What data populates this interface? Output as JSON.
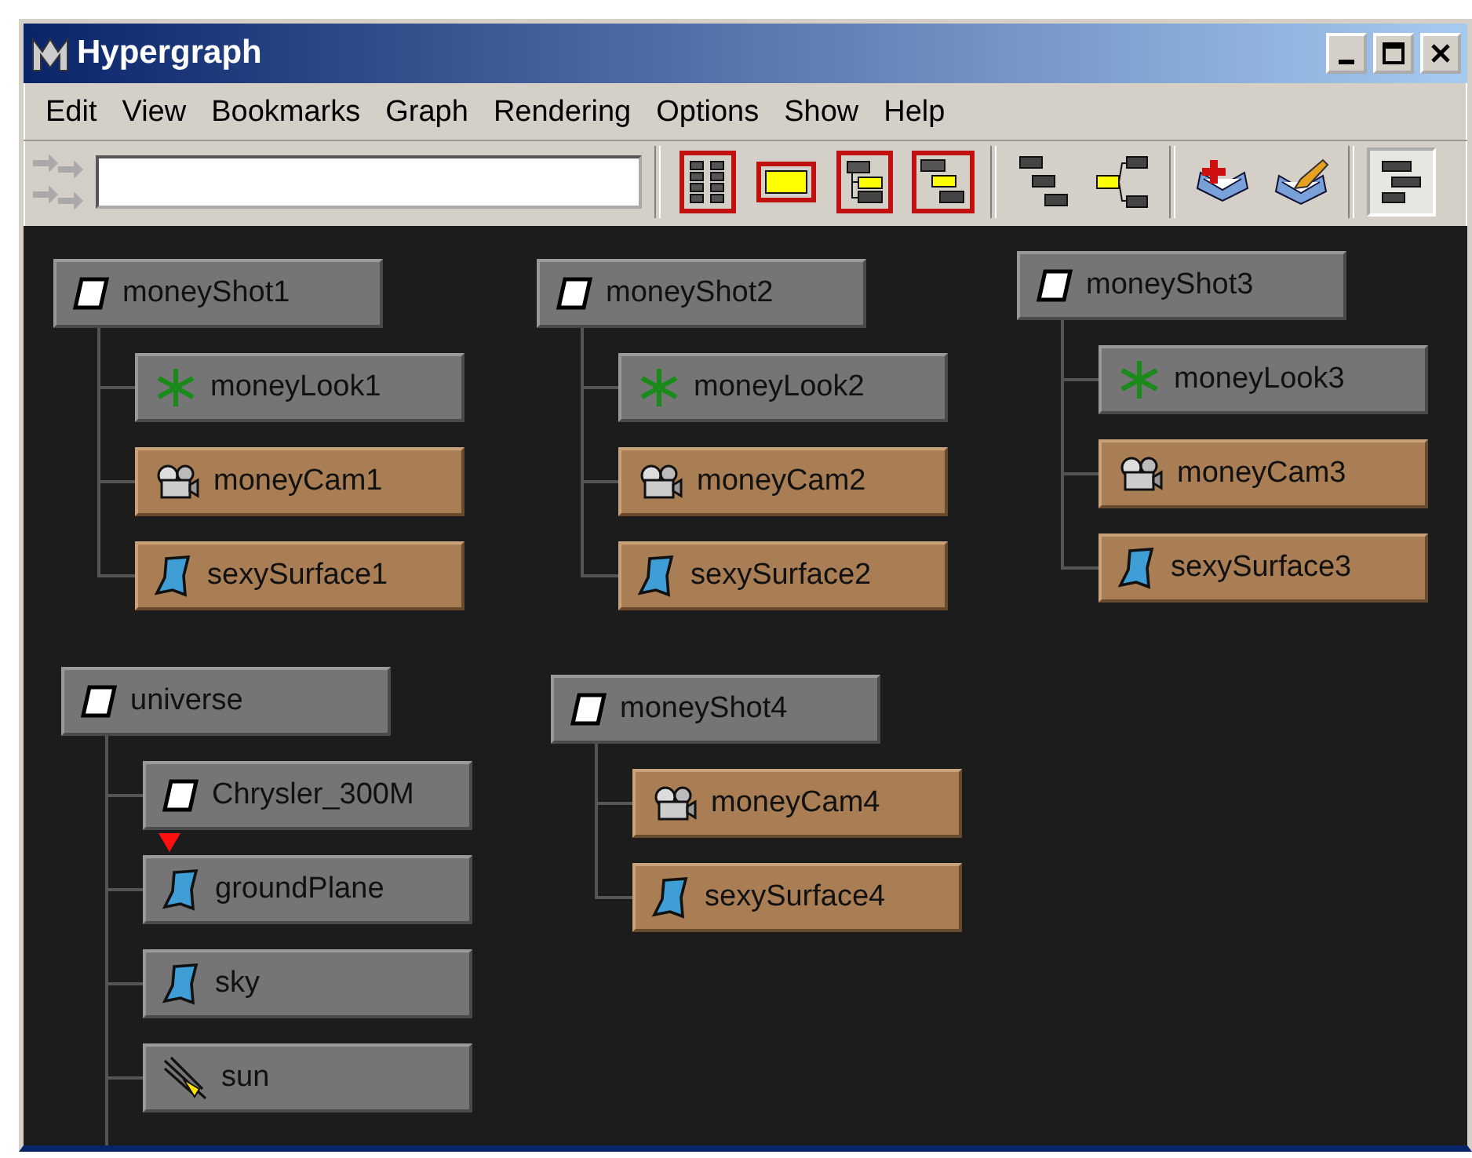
{
  "window": {
    "title": "Hypergraph"
  },
  "menu": [
    "Edit",
    "View",
    "Bookmarks",
    "Graph",
    "Rendering",
    "Options",
    "Show",
    "Help"
  ],
  "toolbar": {
    "groups": [
      [
        {
          "kind": "scene",
          "framed": true,
          "pressed": false
        },
        {
          "kind": "single",
          "framed": true,
          "pressed": false
        },
        {
          "kind": "children",
          "framed": true,
          "pressed": false
        },
        {
          "kind": "parents",
          "framed": true,
          "pressed": false
        }
      ],
      [
        {
          "kind": "tree-down",
          "framed": false,
          "pressed": false
        },
        {
          "kind": "tree-up",
          "framed": false,
          "pressed": false
        }
      ],
      [
        {
          "kind": "book",
          "framed": false,
          "pressed": false
        },
        {
          "kind": "pencil",
          "framed": false,
          "pressed": false
        }
      ],
      [
        {
          "kind": "layout",
          "framed": false,
          "pressed": true
        }
      ]
    ]
  },
  "graph": [
    {
      "node": {
        "name": "moneyShot1",
        "kind": "transform",
        "highlighted": false
      },
      "children": [
        {
          "name": "moneyLook1",
          "kind": "look",
          "highlighted": false
        },
        {
          "name": "moneyCam1",
          "kind": "camera",
          "highlighted": true
        },
        {
          "name": "sexySurface1",
          "kind": "surface",
          "highlighted": true
        }
      ]
    },
    {
      "node": {
        "name": "moneyShot2",
        "kind": "transform",
        "highlighted": false
      },
      "children": [
        {
          "name": "moneyLook2",
          "kind": "look",
          "highlighted": false
        },
        {
          "name": "moneyCam2",
          "kind": "camera",
          "highlighted": true
        },
        {
          "name": "sexySurface2",
          "kind": "surface",
          "highlighted": true
        }
      ]
    },
    {
      "node": {
        "name": "moneyShot3",
        "kind": "transform",
        "highlighted": false
      },
      "children": [
        {
          "name": "moneyLook3",
          "kind": "look",
          "highlighted": false
        },
        {
          "name": "moneyCam3",
          "kind": "camera",
          "highlighted": true
        },
        {
          "name": "sexySurface3",
          "kind": "surface",
          "highlighted": true
        }
      ]
    },
    {
      "node": {
        "name": "universe",
        "kind": "transform",
        "highlighted": false
      },
      "continues": true,
      "children": [
        {
          "name": "Chrysler_300M",
          "kind": "transform",
          "highlighted": false,
          "flagged": true
        },
        {
          "name": "groundPlane",
          "kind": "surface",
          "highlighted": false
        },
        {
          "name": "sky",
          "kind": "surface",
          "highlighted": false
        },
        {
          "name": "sun",
          "kind": "light",
          "highlighted": false
        }
      ]
    },
    {
      "node": {
        "name": "moneyShot4",
        "kind": "transform",
        "highlighted": false
      },
      "children": [
        {
          "name": "moneyCam4",
          "kind": "camera",
          "highlighted": true
        },
        {
          "name": "sexySurface4",
          "kind": "surface",
          "highlighted": true
        }
      ]
    }
  ]
}
